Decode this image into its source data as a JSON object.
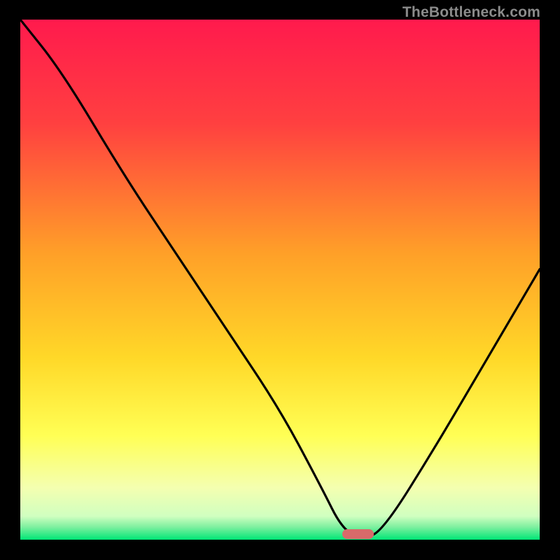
{
  "watermark": "TheBottleneck.com",
  "colors": {
    "background": "#000000",
    "gradient_top": "#ff1a4d",
    "gradient_mid1": "#ff6a2a",
    "gradient_mid2": "#ffd02a",
    "gradient_mid3": "#ffff66",
    "gradient_mid4": "#e6ffb3",
    "gradient_bottom": "#00e676",
    "curve": "#000000",
    "marker": "#d86a6a"
  },
  "chart_data": {
    "type": "line",
    "title": "",
    "xlabel": "",
    "ylabel": "",
    "xlim": [
      0,
      100
    ],
    "ylim": [
      0,
      100
    ],
    "grid": false,
    "legend": false,
    "series": [
      {
        "name": "bottleneck-curve",
        "x": [
          0,
          8,
          20,
          30,
          40,
          50,
          58,
          62,
          66,
          70,
          80,
          90,
          100
        ],
        "values": [
          100,
          90,
          70,
          55,
          40,
          25,
          10,
          2,
          0,
          2,
          18,
          35,
          52
        ]
      }
    ],
    "optimal_marker": {
      "x_start": 62,
      "x_end": 68,
      "y": 0
    },
    "gradient_stops": [
      {
        "offset": 0.0,
        "color": "#ff1a4d"
      },
      {
        "offset": 0.2,
        "color": "#ff4040"
      },
      {
        "offset": 0.45,
        "color": "#ffa028"
      },
      {
        "offset": 0.65,
        "color": "#ffd828"
      },
      {
        "offset": 0.8,
        "color": "#ffff55"
      },
      {
        "offset": 0.9,
        "color": "#f4ffb0"
      },
      {
        "offset": 0.955,
        "color": "#d0ffc0"
      },
      {
        "offset": 0.975,
        "color": "#80f0a0"
      },
      {
        "offset": 1.0,
        "color": "#00e676"
      }
    ]
  }
}
